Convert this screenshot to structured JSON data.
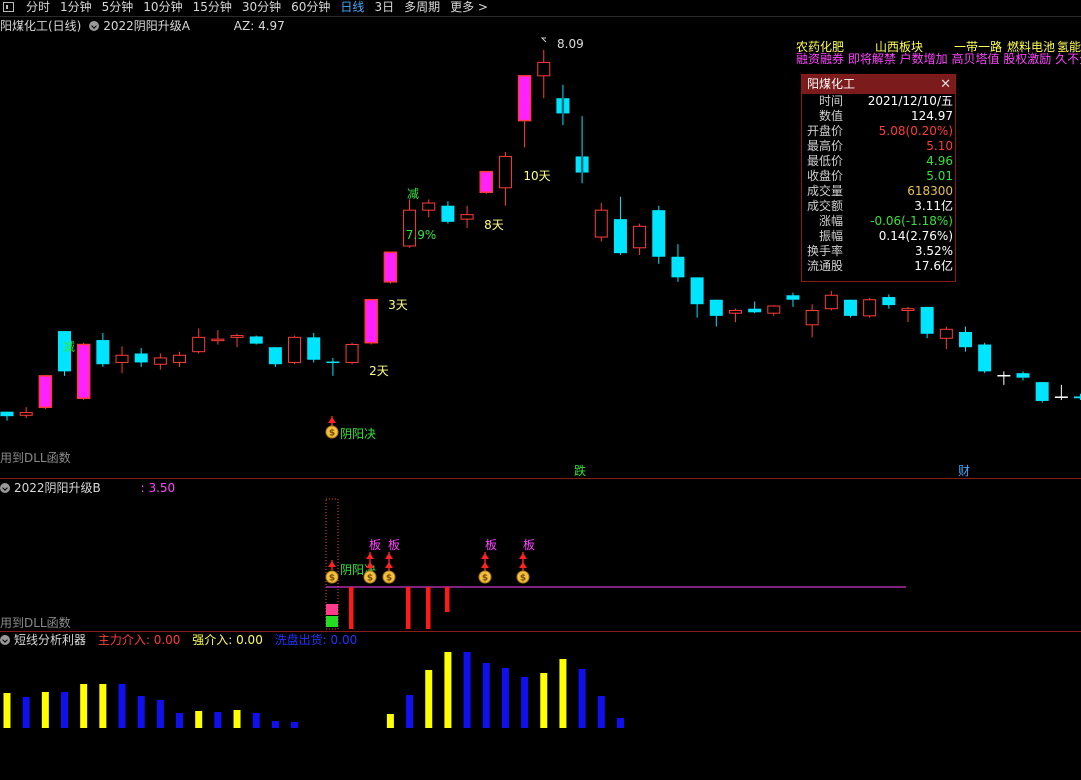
{
  "toolbar": {
    "periods": [
      "分时",
      "1分钟",
      "5分钟",
      "10分钟",
      "15分钟",
      "30分钟",
      "60分钟",
      "日线",
      "3日",
      "多周期",
      "更多 >"
    ],
    "active": "日线"
  },
  "main_panel": {
    "stock": "阳煤化工(日线)",
    "indicator": "2022阴阳升级A",
    "az_label": "AZ: 4.97",
    "dll_note": "用到DLL函数",
    "high_label": "8.09",
    "annotations": [
      "减",
      "减",
      "7.9%",
      "3天",
      "2天",
      "8天",
      "10天",
      "阴阳决",
      "跌",
      "财"
    ]
  },
  "tickers": {
    "line1": [
      "农药化肥",
      "山西板块",
      "一带一路",
      "燃料电池",
      "氢能"
    ],
    "line2": "融资融券 即将解禁 户数增加 高贝塔值 股权激励 久不分"
  },
  "info_box": {
    "title": "阳煤化工",
    "rows": [
      {
        "k": "时间",
        "v": "2021/12/10/五",
        "c": "#ffffff"
      },
      {
        "k": "数值",
        "v": "124.97",
        "c": "#ffffff"
      },
      {
        "k": "开盘价",
        "v": "5.08(0.20%)",
        "c": "#ff3b3b"
      },
      {
        "k": "最高价",
        "v": "5.10",
        "c": "#ff3b3b"
      },
      {
        "k": "最低价",
        "v": "4.96",
        "c": "#33e33b"
      },
      {
        "k": "收盘价",
        "v": "5.01",
        "c": "#33e33b"
      },
      {
        "k": "成交量",
        "v": "618300",
        "c": "#e8c14a"
      },
      {
        "k": "成交额",
        "v": "3.11亿",
        "c": "#ffffff"
      },
      {
        "k": "涨幅",
        "v": "-0.06(-1.18%)",
        "c": "#33e33b"
      },
      {
        "k": "振幅",
        "v": "0.14(2.76%)",
        "c": "#ffffff"
      },
      {
        "k": "换手率",
        "v": "3.52%",
        "c": "#ffffff"
      },
      {
        "k": "流通股",
        "v": "17.6亿",
        "c": "#ffffff"
      }
    ]
  },
  "sub_panel": {
    "indicator": "2022阴阳升级B",
    "value": ": 3.50",
    "dll_note": "用到DLL函数",
    "ban_label": "板",
    "yy_label": "阴阳决"
  },
  "bottom_panel": {
    "indicator": "短线分析利器",
    "zhuli": "主力介入: 0.00",
    "qiang": "强介入: 0.00",
    "xipan": "洗盘出货: 0.00"
  },
  "chart_data": {
    "type": "candlestick",
    "ylim": [
      3.6,
      8.2
    ],
    "candles": [
      {
        "o": 4.0,
        "h": 4.05,
        "l": 3.95,
        "c": 4.05,
        "k": "cyan"
      },
      {
        "o": 4.01,
        "h": 4.1,
        "l": 3.98,
        "c": 4.04,
        "k": "hollow"
      },
      {
        "o": 4.1,
        "h": 4.46,
        "l": 4.08,
        "c": 4.45,
        "k": "magenta"
      },
      {
        "o": 4.5,
        "h": 4.88,
        "l": 4.45,
        "c": 4.95,
        "k": "cyan"
      },
      {
        "o": 4.2,
        "h": 4.82,
        "l": 4.18,
        "c": 4.8,
        "k": "magenta"
      },
      {
        "o": 4.85,
        "h": 4.93,
        "l": 4.55,
        "c": 4.58,
        "k": "cyan"
      },
      {
        "o": 4.6,
        "h": 4.78,
        "l": 4.48,
        "c": 4.68,
        "k": "hollow"
      },
      {
        "o": 4.7,
        "h": 4.76,
        "l": 4.55,
        "c": 4.6,
        "k": "cyan"
      },
      {
        "o": 4.58,
        "h": 4.7,
        "l": 4.52,
        "c": 4.65,
        "k": "hollow"
      },
      {
        "o": 4.6,
        "h": 4.72,
        "l": 4.55,
        "c": 4.68,
        "k": "hollow"
      },
      {
        "o": 4.72,
        "h": 4.98,
        "l": 4.7,
        "c": 4.88,
        "k": "hollow"
      },
      {
        "o": 4.86,
        "h": 4.96,
        "l": 4.8,
        "c": 4.86,
        "k": "hollow"
      },
      {
        "o": 4.88,
        "h": 4.92,
        "l": 4.77,
        "c": 4.9,
        "k": "hollow"
      },
      {
        "o": 4.89,
        "h": 4.9,
        "l": 4.8,
        "c": 4.81,
        "k": "cyan"
      },
      {
        "o": 4.77,
        "h": 4.77,
        "l": 4.55,
        "c": 4.58,
        "k": "cyan"
      },
      {
        "o": 4.6,
        "h": 4.9,
        "l": 4.58,
        "c": 4.88,
        "k": "hollow"
      },
      {
        "o": 4.88,
        "h": 4.93,
        "l": 4.6,
        "c": 4.63,
        "k": "cyan"
      },
      {
        "o": 4.61,
        "h": 4.65,
        "l": 4.45,
        "c": 4.6,
        "k": "cyan"
      },
      {
        "o": 4.6,
        "h": 4.82,
        "l": 4.58,
        "c": 4.8,
        "k": "hollow"
      },
      {
        "o": 4.82,
        "h": 5.3,
        "l": 4.8,
        "c": 5.3,
        "k": "magenta"
      },
      {
        "o": 5.5,
        "h": 5.83,
        "l": 5.48,
        "c": 5.83,
        "k": "magenta"
      },
      {
        "o": 5.9,
        "h": 6.42,
        "l": 5.88,
        "c": 6.3,
        "k": "hollow"
      },
      {
        "o": 6.3,
        "h": 6.42,
        "l": 6.22,
        "c": 6.38,
        "k": "hollow"
      },
      {
        "o": 6.35,
        "h": 6.4,
        "l": 6.15,
        "c": 6.17,
        "k": "cyan"
      },
      {
        "o": 6.2,
        "h": 6.35,
        "l": 6.1,
        "c": 6.25,
        "k": "hollow"
      },
      {
        "o": 6.5,
        "h": 6.73,
        "l": 6.48,
        "c": 6.73,
        "k": "magenta"
      },
      {
        "o": 6.55,
        "h": 6.95,
        "l": 6.35,
        "c": 6.9,
        "k": "hollow"
      },
      {
        "o": 7.3,
        "h": 7.8,
        "l": 7.0,
        "c": 7.8,
        "k": "magenta"
      },
      {
        "o": 7.8,
        "h": 8.09,
        "l": 7.55,
        "c": 7.95,
        "k": "hollow"
      },
      {
        "o": 7.55,
        "h": 7.7,
        "l": 7.25,
        "c": 7.38,
        "k": "cyan"
      },
      {
        "o": 6.9,
        "h": 7.35,
        "l": 6.6,
        "c": 6.72,
        "k": "cyan"
      },
      {
        "o": 6.3,
        "h": 6.38,
        "l": 5.95,
        "c": 6.0,
        "k": "hollow"
      },
      {
        "o": 6.2,
        "h": 6.45,
        "l": 5.8,
        "c": 5.82,
        "k": "cyan"
      },
      {
        "o": 5.88,
        "h": 6.15,
        "l": 5.8,
        "c": 6.12,
        "k": "hollow"
      },
      {
        "o": 6.3,
        "h": 6.35,
        "l": 5.7,
        "c": 5.78,
        "k": "cyan"
      },
      {
        "o": 5.78,
        "h": 5.92,
        "l": 5.5,
        "c": 5.55,
        "k": "cyan"
      },
      {
        "o": 5.55,
        "h": 5.55,
        "l": 5.1,
        "c": 5.25,
        "k": "cyan"
      },
      {
        "o": 5.3,
        "h": 5.3,
        "l": 5.0,
        "c": 5.12,
        "k": "cyan"
      },
      {
        "o": 5.15,
        "h": 5.2,
        "l": 5.05,
        "c": 5.18,
        "k": "hollow"
      },
      {
        "o": 5.2,
        "h": 5.28,
        "l": 5.15,
        "c": 5.16,
        "k": "cyan"
      },
      {
        "o": 5.15,
        "h": 5.24,
        "l": 5.12,
        "c": 5.23,
        "k": "hollow"
      },
      {
        "o": 5.35,
        "h": 5.38,
        "l": 5.22,
        "c": 5.3,
        "k": "cyan"
      },
      {
        "o": 5.02,
        "h": 5.25,
        "l": 4.88,
        "c": 5.18,
        "k": "hollow"
      },
      {
        "o": 5.2,
        "h": 5.4,
        "l": 5.18,
        "c": 5.35,
        "k": "hollow"
      },
      {
        "o": 5.3,
        "h": 5.3,
        "l": 5.1,
        "c": 5.12,
        "k": "cyan"
      },
      {
        "o": 5.12,
        "h": 5.32,
        "l": 5.1,
        "c": 5.3,
        "k": "hollow"
      },
      {
        "o": 5.33,
        "h": 5.36,
        "l": 5.2,
        "c": 5.24,
        "k": "cyan"
      },
      {
        "o": 5.18,
        "h": 5.22,
        "l": 5.05,
        "c": 5.2,
        "k": "hollow"
      },
      {
        "o": 5.22,
        "h": 5.22,
        "l": 4.87,
        "c": 4.92,
        "k": "cyan"
      },
      {
        "o": 4.87,
        "h": 5.0,
        "l": 4.75,
        "c": 4.97,
        "k": "hollow"
      },
      {
        "o": 4.94,
        "h": 5.0,
        "l": 4.72,
        "c": 4.77,
        "k": "cyan"
      },
      {
        "o": 4.8,
        "h": 4.82,
        "l": 4.48,
        "c": 4.5,
        "k": "cyan"
      },
      {
        "o": 4.45,
        "h": 4.5,
        "l": 4.35,
        "c": 4.46,
        "k": "white"
      },
      {
        "o": 4.48,
        "h": 4.5,
        "l": 4.4,
        "c": 4.43,
        "k": "cyan"
      },
      {
        "o": 4.38,
        "h": 4.38,
        "l": 4.15,
        "c": 4.17,
        "k": "cyan"
      },
      {
        "o": 4.22,
        "h": 4.35,
        "l": 4.18,
        "c": 4.22,
        "k": "white"
      },
      {
        "o": 4.22,
        "h": 4.25,
        "l": 4.18,
        "c": 4.2,
        "k": "cyan"
      }
    ],
    "bottom_bars": [
      {
        "v": 0.35,
        "c": "y"
      },
      {
        "v": 0.31,
        "c": "b"
      },
      {
        "v": 0.36,
        "c": "y"
      },
      {
        "v": 0.36,
        "c": "b"
      },
      {
        "v": 0.44,
        "c": "y"
      },
      {
        "v": 0.44,
        "c": "y"
      },
      {
        "v": 0.44,
        "c": "b"
      },
      {
        "v": 0.32,
        "c": "b"
      },
      {
        "v": 0.28,
        "c": "b"
      },
      {
        "v": 0.15,
        "c": "b"
      },
      {
        "v": 0.17,
        "c": "y"
      },
      {
        "v": 0.16,
        "c": "b"
      },
      {
        "v": 0.18,
        "c": "y"
      },
      {
        "v": 0.15,
        "c": "b"
      },
      {
        "v": 0.07,
        "c": "b"
      },
      {
        "v": 0.06,
        "c": "b"
      },
      {
        "v": 0,
        "c": "b"
      },
      {
        "v": 0,
        "c": "b"
      },
      {
        "v": 0,
        "c": "b"
      },
      {
        "v": 0,
        "c": "b"
      },
      {
        "v": 0.14,
        "c": "y"
      },
      {
        "v": 0.33,
        "c": "b"
      },
      {
        "v": 0.58,
        "c": "y"
      },
      {
        "v": 0.76,
        "c": "y"
      },
      {
        "v": 0.76,
        "c": "b"
      },
      {
        "v": 0.65,
        "c": "b"
      },
      {
        "v": 0.6,
        "c": "b"
      },
      {
        "v": 0.51,
        "c": "b"
      },
      {
        "v": 0.55,
        "c": "y"
      },
      {
        "v": 0.69,
        "c": "y"
      },
      {
        "v": 0.59,
        "c": "b"
      },
      {
        "v": 0.32,
        "c": "b"
      },
      {
        "v": 0.1,
        "c": "b"
      }
    ]
  }
}
